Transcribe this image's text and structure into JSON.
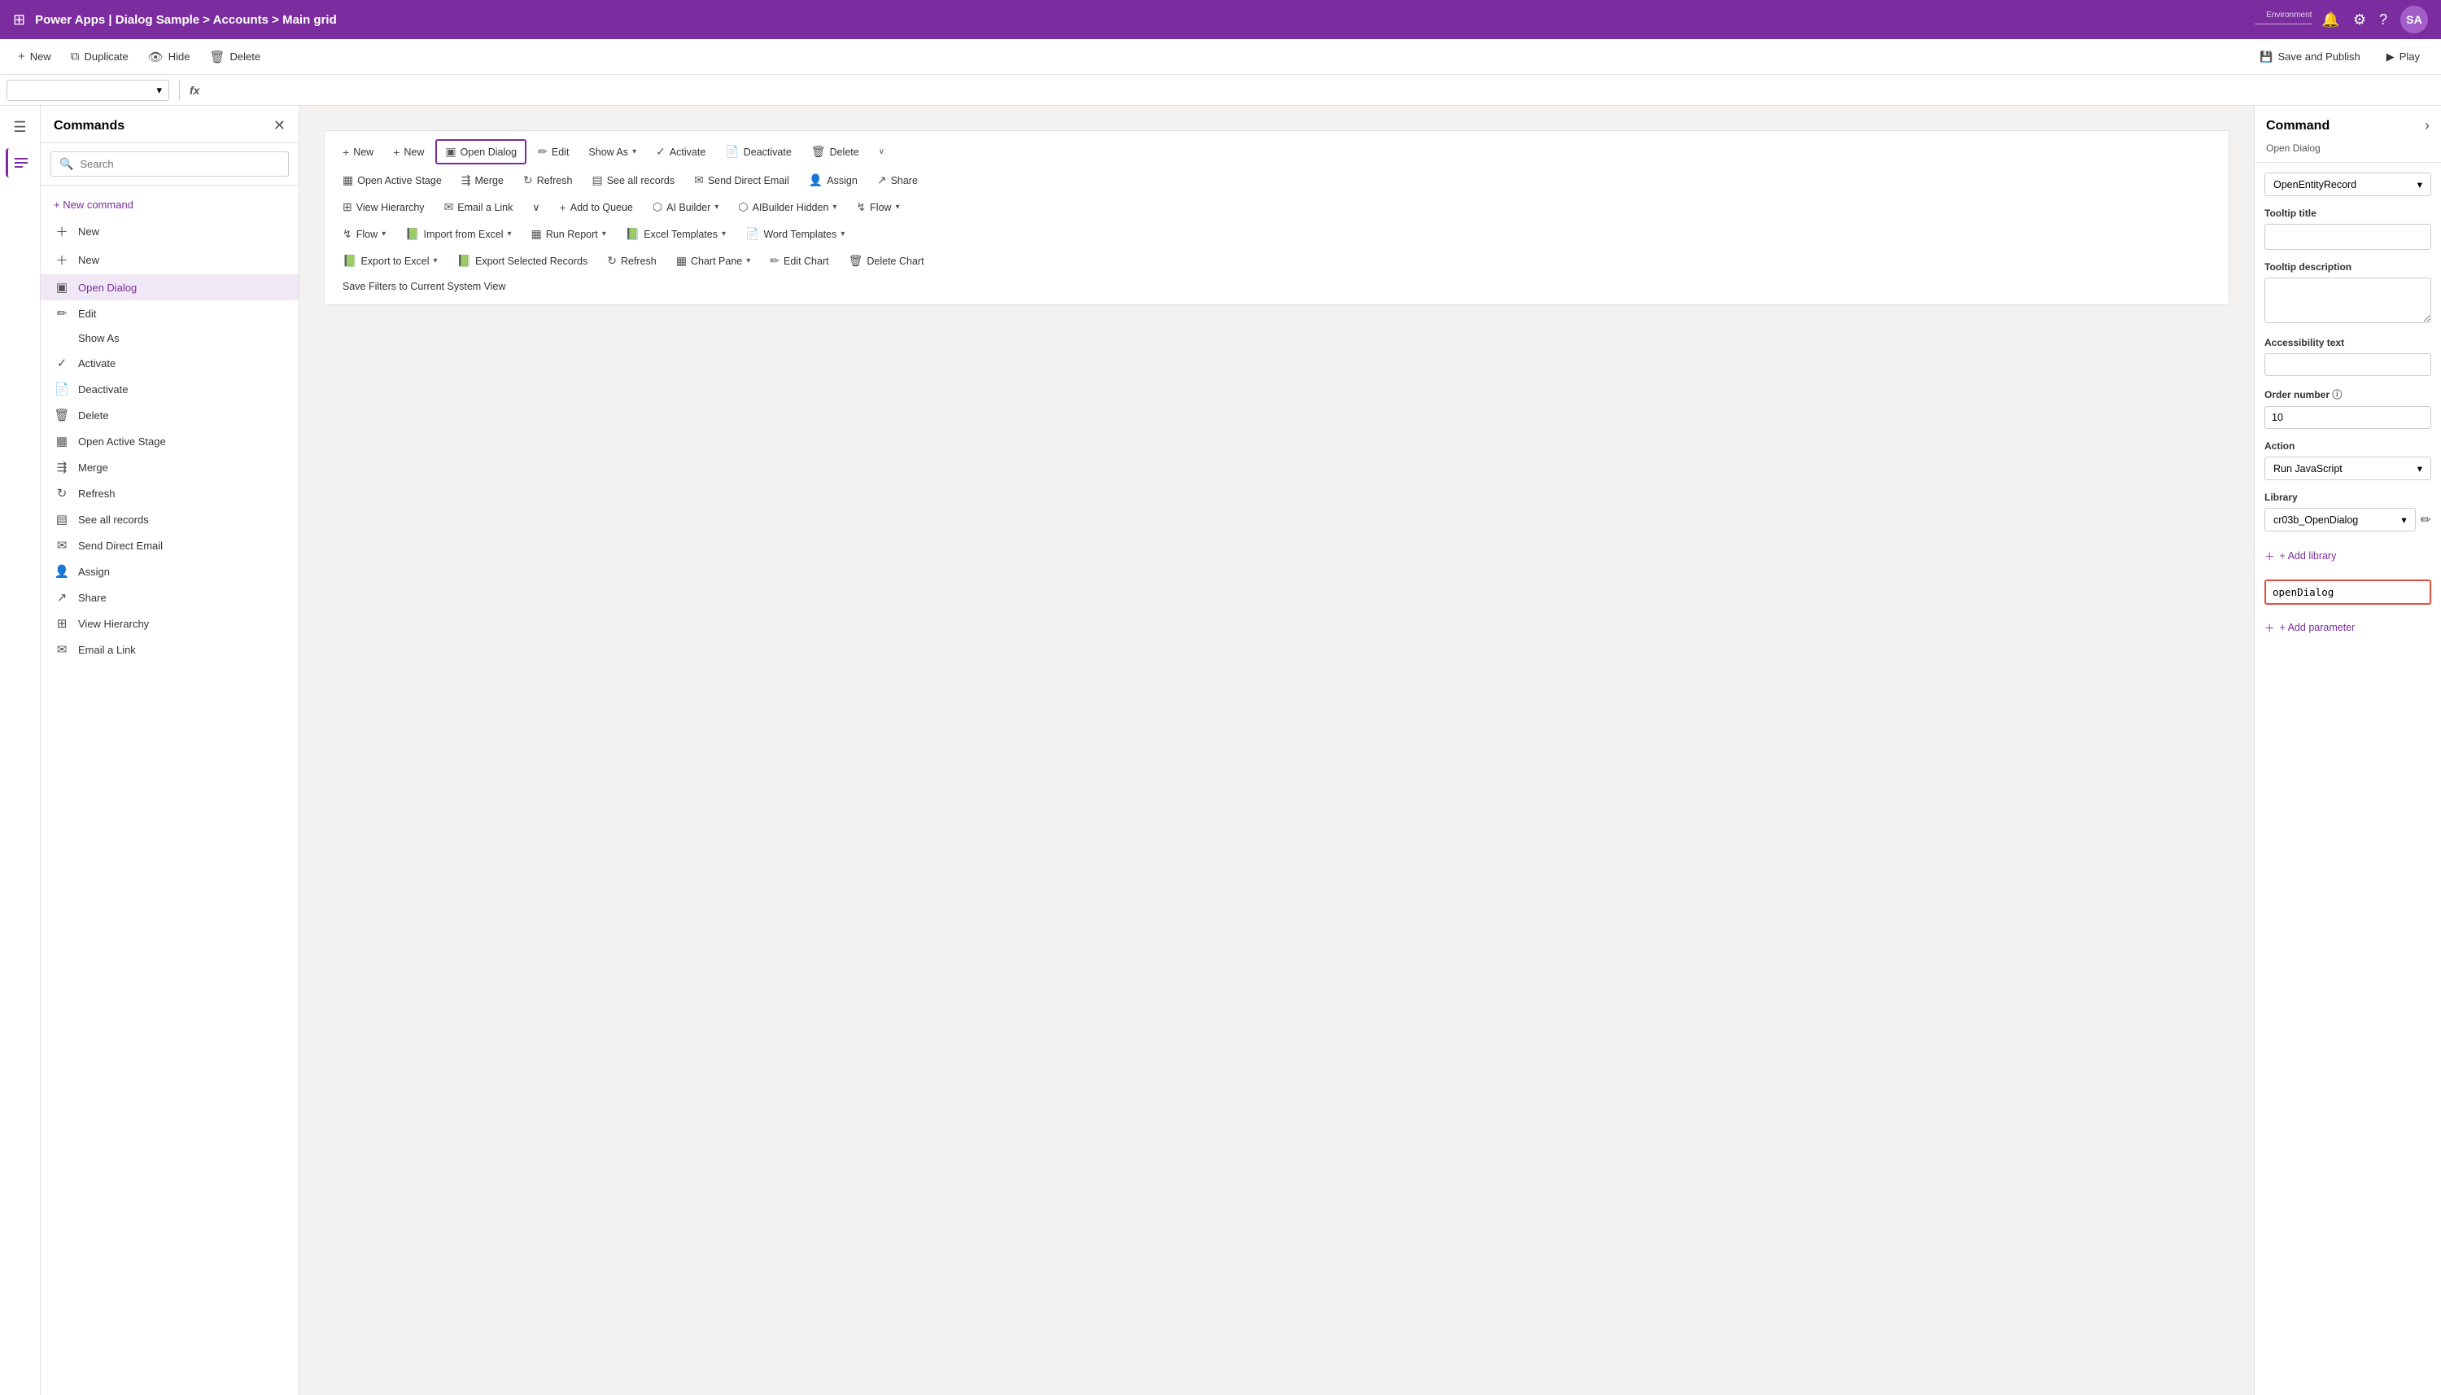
{
  "topNav": {
    "waffle_icon": "⊞",
    "title": "Power Apps  |  Dialog Sample > Accounts > Main grid",
    "env_label": "Environment",
    "env_value": "———————",
    "bell_icon": "🔔",
    "gear_icon": "⚙",
    "help_icon": "?",
    "avatar_label": "SA"
  },
  "toolbar": {
    "new_icon": "+",
    "new_label": "New",
    "duplicate_icon": "⧉",
    "duplicate_label": "Duplicate",
    "hide_icon": "👁",
    "hide_label": "Hide",
    "delete_icon": "🗑",
    "delete_label": "Delete",
    "save_publish_icon": "💾",
    "save_publish_label": "Save and Publish",
    "play_icon": "▶",
    "play_label": "Play"
  },
  "formulaBar": {
    "dropdown_value": "",
    "fx_label": "fx"
  },
  "sidebar": {
    "title": "Commands",
    "close_icon": "✕",
    "search_placeholder": "Search",
    "search_icon": "🔍",
    "new_command_label": "+ New command",
    "items": [
      {
        "id": "new1",
        "icon": "+",
        "label": "New",
        "type": "plus"
      },
      {
        "id": "new2",
        "icon": "+",
        "label": "New",
        "type": "plus"
      },
      {
        "id": "open-dialog",
        "icon": "▣",
        "label": "Open Dialog",
        "active": true
      },
      {
        "id": "edit",
        "icon": "✏",
        "label": "Edit"
      },
      {
        "id": "show-as",
        "icon": "",
        "label": "Show As",
        "indent": true
      },
      {
        "id": "activate",
        "icon": "✓",
        "label": "Activate"
      },
      {
        "id": "deactivate",
        "icon": "📄",
        "label": "Deactivate"
      },
      {
        "id": "delete",
        "icon": "🗑",
        "label": "Delete"
      },
      {
        "id": "open-active-stage",
        "icon": "▦",
        "label": "Open Active Stage"
      },
      {
        "id": "merge",
        "icon": "⇶",
        "label": "Merge"
      },
      {
        "id": "refresh",
        "icon": "↻",
        "label": "Refresh"
      },
      {
        "id": "see-all-records",
        "icon": "▤",
        "label": "See all records"
      },
      {
        "id": "send-direct-email",
        "icon": "✉",
        "label": "Send Direct Email"
      },
      {
        "id": "assign",
        "icon": "👤",
        "label": "Assign"
      },
      {
        "id": "share",
        "icon": "↗",
        "label": "Share"
      },
      {
        "id": "view-hierarchy",
        "icon": "⊞",
        "label": "View Hierarchy"
      },
      {
        "id": "email-a-link",
        "icon": "✉",
        "label": "Email a Link"
      }
    ]
  },
  "canvas": {
    "ribbon": {
      "row1": [
        {
          "id": "new-r1",
          "icon": "+",
          "label": "New"
        },
        {
          "id": "new-r2",
          "icon": "+",
          "label": "New"
        },
        {
          "id": "open-dialog",
          "icon": "▣",
          "label": "Open Dialog",
          "selected": true
        },
        {
          "id": "edit",
          "icon": "✏",
          "label": "Edit"
        },
        {
          "id": "show-as",
          "icon": "",
          "label": "Show As",
          "chevron": true
        },
        {
          "id": "activate",
          "icon": "✓",
          "label": "Activate"
        },
        {
          "id": "deactivate",
          "icon": "📄",
          "label": "Deactivate"
        },
        {
          "id": "delete",
          "icon": "🗑",
          "label": "Delete"
        },
        {
          "id": "more-r1",
          "icon": "∨",
          "label": ""
        }
      ],
      "row2": [
        {
          "id": "open-active-stage",
          "icon": "▦",
          "label": "Open Active Stage"
        },
        {
          "id": "merge",
          "icon": "⇶",
          "label": "Merge"
        },
        {
          "id": "refresh",
          "icon": "↻",
          "label": "Refresh"
        },
        {
          "id": "see-all-records",
          "icon": "▤",
          "label": "See all records"
        },
        {
          "id": "send-direct-email",
          "icon": "✉",
          "label": "Send Direct Email"
        },
        {
          "id": "assign",
          "icon": "👤",
          "label": "Assign"
        },
        {
          "id": "share",
          "icon": "↗",
          "label": "Share"
        }
      ],
      "row3": [
        {
          "id": "view-hierarchy",
          "icon": "⊞",
          "label": "View Hierarchy"
        },
        {
          "id": "email-a-link",
          "icon": "✉",
          "label": "Email a Link"
        },
        {
          "id": "chevron-r3",
          "icon": "∨",
          "label": ""
        },
        {
          "id": "add-to-queue",
          "icon": "+",
          "label": "Add to Queue"
        },
        {
          "id": "ai-builder",
          "icon": "⬡",
          "label": "AI Builder",
          "chevron": true
        },
        {
          "id": "aibuilder-hidden",
          "icon": "⬡",
          "label": "AIBuilder Hidden",
          "chevron": true
        },
        {
          "id": "flow",
          "icon": "↯",
          "label": "Flow",
          "chevron": true
        }
      ],
      "row4": [
        {
          "id": "flow-r4",
          "icon": "↯",
          "label": "Flow",
          "chevron": true
        },
        {
          "id": "import-excel",
          "icon": "📗",
          "label": "Import from Excel",
          "chevron": true
        },
        {
          "id": "run-report",
          "icon": "▦",
          "label": "Run Report",
          "chevron": true
        },
        {
          "id": "excel-templates",
          "icon": "📗",
          "label": "Excel Templates",
          "chevron": true
        },
        {
          "id": "word-templates",
          "icon": "📄",
          "label": "Word Templates",
          "chevron": true
        }
      ],
      "row5": [
        {
          "id": "export-excel",
          "icon": "📗",
          "label": "Export to Excel",
          "chevron": true
        },
        {
          "id": "export-selected",
          "icon": "📗",
          "label": "Export Selected Records"
        },
        {
          "id": "refresh-r5",
          "icon": "↻",
          "label": "Refresh"
        },
        {
          "id": "chart-pane",
          "icon": "▦",
          "label": "Chart Pane",
          "chevron": true
        },
        {
          "id": "edit-chart",
          "icon": "✏",
          "label": "Edit Chart"
        },
        {
          "id": "delete-chart",
          "icon": "🗑",
          "label": "Delete Chart"
        }
      ],
      "row6": [
        {
          "id": "save-filters",
          "icon": "",
          "label": "Save Filters to Current System View"
        }
      ]
    }
  },
  "rightPanel": {
    "title": "Command",
    "subtitle": "Open Dialog",
    "expand_icon": "›",
    "dropdown_label": "OpenEntityRecord",
    "tooltip_title_label": "Tooltip title",
    "tooltip_title_value": "",
    "tooltip_desc_label": "Tooltip description",
    "tooltip_desc_value": "",
    "accessibility_label": "Accessibility text",
    "accessibility_value": "",
    "order_label": "Order number",
    "order_value": "10",
    "action_label": "Action",
    "action_value": "Run JavaScript",
    "library_label": "Library",
    "library_value": "cr03b_OpenDialog",
    "edit_icon": "✏",
    "add_library_label": "+ Add library",
    "function_value": "openDialog",
    "add_param_label": "+ Add parameter"
  }
}
